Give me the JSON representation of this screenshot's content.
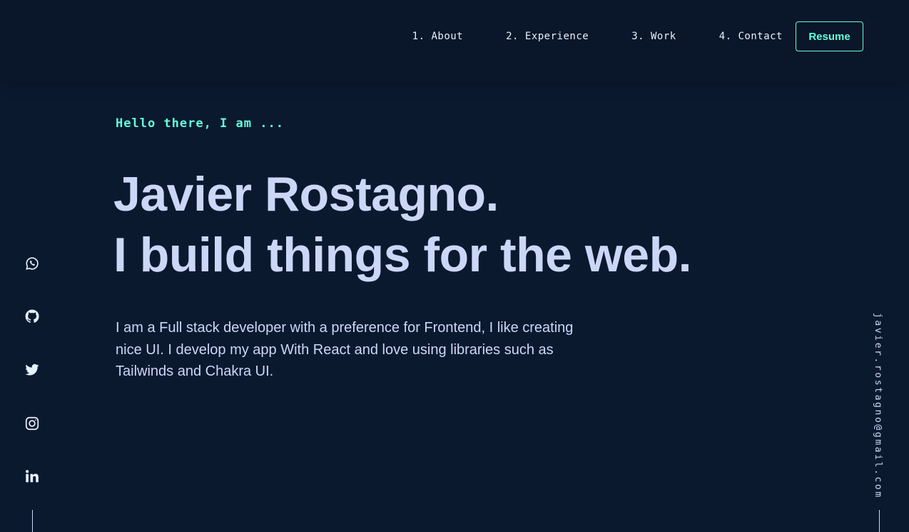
{
  "nav": {
    "links": [
      {
        "label": "1. About"
      },
      {
        "label": "2. Experience"
      },
      {
        "label": "3. Work"
      },
      {
        "label": "4. Contact"
      }
    ],
    "resume_label": "Resume"
  },
  "hero": {
    "greeting": "Hello there, I am ...",
    "name": "Javier Rostagno.",
    "tagline": "I build things for the web.",
    "description": "I am a Full stack developer with a preference for Frontend, I like creating nice UI. I develop my app With React and love using libraries such as Tailwinds and Chakra UI."
  },
  "social": {
    "icons": [
      "whatsapp-icon",
      "github-icon",
      "twitter-icon",
      "instagram-icon",
      "linkedin-icon"
    ]
  },
  "email": "javier.rostagno@gmail.com",
  "colors": {
    "background": "#0b192f",
    "navbar": "#0a1629",
    "accent": "#64ffda",
    "text": "#ccd6f6"
  }
}
